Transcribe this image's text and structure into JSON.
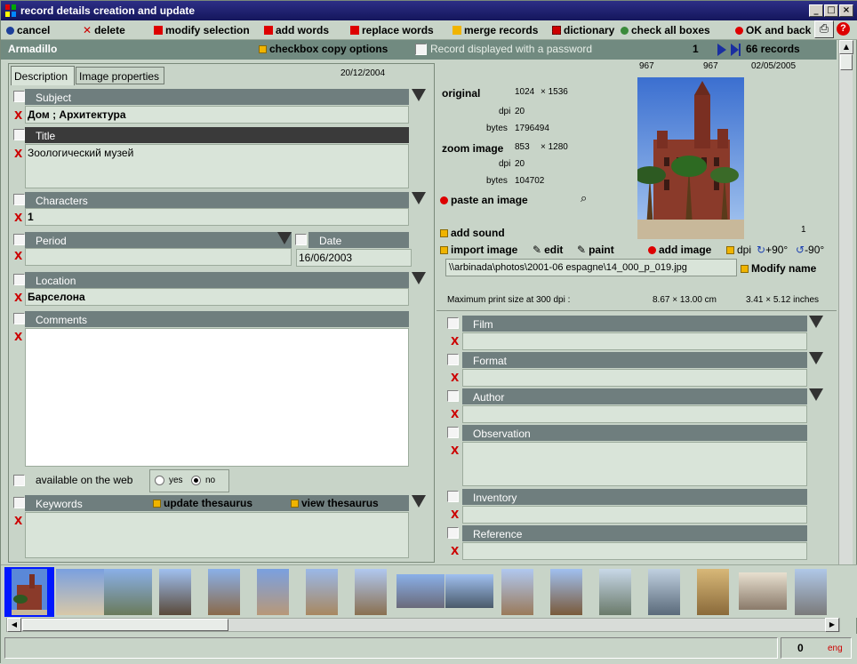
{
  "window": {
    "title": "record details creation and update"
  },
  "toolbar": {
    "cancel": "cancel",
    "delete": "delete",
    "modify_selection": "modify selection",
    "add_words": "add words",
    "replace_words": "replace words",
    "merge_records": "merge records",
    "dictionary": "dictionary",
    "check_all_boxes": "check all boxes",
    "ok_and_back": "OK and back"
  },
  "recordbar": {
    "name": "Armadillo",
    "checkbox_copy_options": "checkbox copy options",
    "password_label": "Record displayed with a password",
    "record_index": "1",
    "record_count": "66 records"
  },
  "left": {
    "tabs": [
      "Description",
      "Image properties"
    ],
    "date": "20/12/2004",
    "subject": {
      "label": "Subject",
      "value": "Дом ; Архитектура"
    },
    "title": {
      "label": "Title",
      "value": "Зоологический музей"
    },
    "characters": {
      "label": "Characters",
      "value": "1"
    },
    "period": {
      "label": "Period",
      "value": ""
    },
    "date_field": {
      "label": "Date",
      "value": "16/06/2003"
    },
    "location": {
      "label": "Location",
      "value": "Барселона"
    },
    "comments": {
      "label": "Comments",
      "value": ""
    },
    "available_web": "available on the web",
    "yes": "yes",
    "no": "no",
    "keywords": {
      "label": "Keywords",
      "value": ""
    },
    "update_thesaurus": "update thesaurus",
    "view_thesaurus": "view thesaurus"
  },
  "right": {
    "top_nums": [
      "967",
      "967",
      "02/05/2005"
    ],
    "original_label": "original",
    "original_w": "1024",
    "original_h": "× 1536",
    "dpi_label": "dpi",
    "original_dpi": "20",
    "bytes_label": "bytes",
    "original_bytes": "1796494",
    "zoom_label": "zoom image",
    "zoom_w": "853",
    "zoom_h": "× 1280",
    "zoom_dpi": "20",
    "zoom_bytes": "104702",
    "paste_image": "paste an image",
    "add_sound": "add sound",
    "sound_count": "1",
    "import_image": "import image",
    "edit": "edit",
    "paint": "paint",
    "add_image": "add image",
    "dpi_btn": "dpi",
    "rot_plus": "+90°",
    "rot_minus": "-90°",
    "path": "\\\\arbinada\\photos\\2001-06 espagne\\14_000_p_019.jpg",
    "modify_name": "Modify name",
    "max_print": "Maximum  print size at 300 dpi :",
    "cm": "8.67 × 13.00  cm",
    "inches": "3.41 × 5.12 inches",
    "fields": [
      {
        "label": "Film",
        "value": ""
      },
      {
        "label": "Format",
        "value": ""
      },
      {
        "label": "Author",
        "value": ""
      },
      {
        "label": "Observation",
        "value": ""
      },
      {
        "label": "Inventory",
        "value": ""
      },
      {
        "label": "Reference",
        "value": ""
      }
    ]
  },
  "status": {
    "count": "0",
    "lang": "eng"
  },
  "colors": {
    "accent_red": "#cc0000",
    "header_grey": "#6f7e7e",
    "panel_bg": "#c8d4c8"
  }
}
